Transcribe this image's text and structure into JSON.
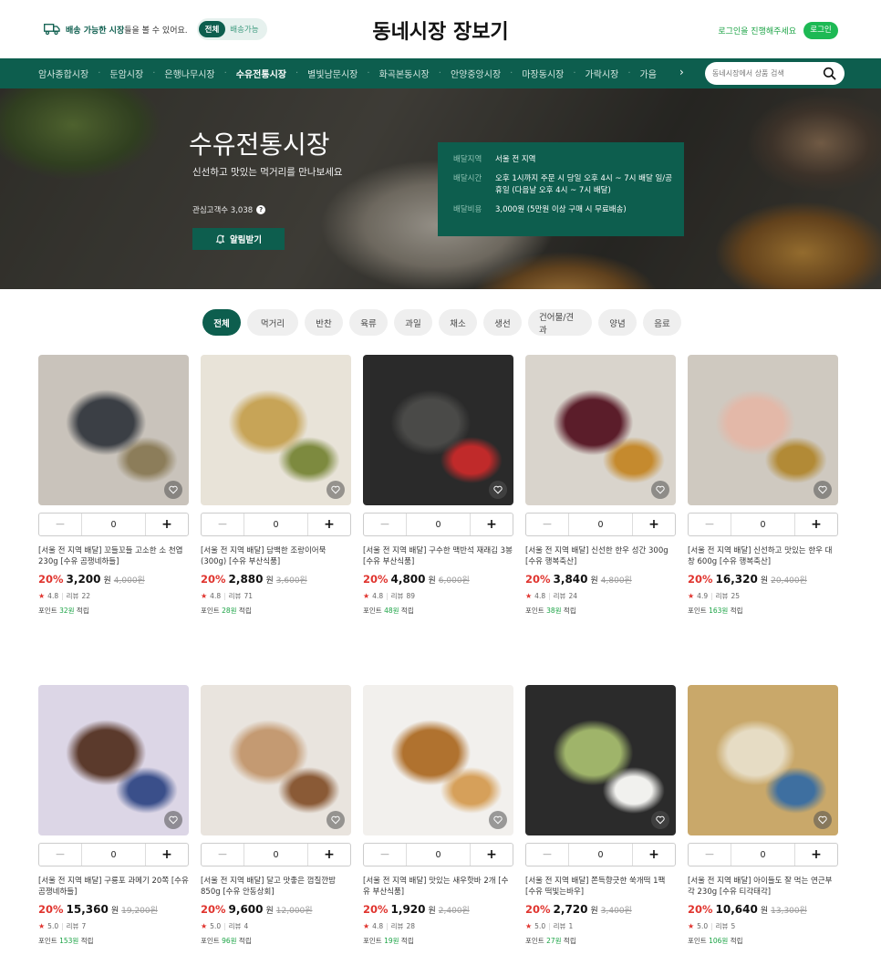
{
  "header": {
    "delivery_prefix": "배송 가능한 시장",
    "delivery_suffix": "들을 볼 수 있어요.",
    "toggle_all": "전체",
    "toggle_deliverable": "배송가능",
    "site_title": "동네시장 장보기",
    "login_prompt": "로그인을 진행해주세요",
    "login_button": "로그인"
  },
  "nav": {
    "items": [
      "암사종합시장",
      "둔암시장",
      "은행나무시장",
      "수유전통시장",
      "별빛남문시장",
      "화곡본동시장",
      "안양중앙시장",
      "마장동시장",
      "가락시장",
      "가음"
    ],
    "active_index": 3,
    "arrow": "›"
  },
  "search": {
    "placeholder": "동네시장에서 상품 검색"
  },
  "hero": {
    "title": "수유전통시장",
    "subtitle": "신선하고 맛있는 먹거리를 만나보세요",
    "followers_label": "관심고객수 3,038",
    "info_mark": "?",
    "notify_button": "알림받기",
    "info": [
      {
        "key": "배달지역",
        "value": "서울 전 지역"
      },
      {
        "key": "배달시간",
        "value": "오후 1시까지 주문 시 당일 오후 4시 ~ 7시 배달 일/공휴일 (다음날 오후 4시 ~ 7시 배달)"
      },
      {
        "key": "배달비용",
        "value": "3,000원 (5만원 이상 구매 시 무료배송)"
      }
    ]
  },
  "categories": [
    "전체",
    "먹거리",
    "반찬",
    "육류",
    "과일",
    "채소",
    "생선",
    "건어물/견과",
    "양념",
    "음료"
  ],
  "labels": {
    "won": "원",
    "review": "리뷰",
    "point_prefix": "포인트 ",
    "point_suffix": " 적립"
  },
  "products": [
    {
      "name": "[서울 전 지역 배달] 꼬들꼬들 고소한 소 천엽 230g [수유 곰쟁네하들]",
      "discount": "20%",
      "price": "3,200",
      "original": "4,000원",
      "rating": "4.8",
      "reviews": "22",
      "points": "32원",
      "qty": "0",
      "colors": [
        "#c9c3bb",
        "#3b3f45",
        "#8c7d5a"
      ]
    },
    {
      "name": "[서울 전 지역 배달] 담백한 조랑이어묵 (300g) [수유 부산식품]",
      "discount": "20%",
      "price": "2,880",
      "original": "3,600원",
      "rating": "4.8",
      "reviews": "71",
      "points": "28원",
      "qty": "0",
      "colors": [
        "#e8e3d8",
        "#c7a457",
        "#7d8a3f"
      ]
    },
    {
      "name": "[서울 전 지역 배달] 구수한 맥반석 재래김 3봉 [수유 부산식품]",
      "discount": "20%",
      "price": "4,800",
      "original": "6,000원",
      "rating": "4.8",
      "reviews": "89",
      "points": "48원",
      "qty": "0",
      "colors": [
        "#2a2a2a",
        "#4a4a48",
        "#c02a2a"
      ]
    },
    {
      "name": "[서울 전 지역 배달] 신선한 한우 성간 300g [수유 행복축산]",
      "discount": "20%",
      "price": "3,840",
      "original": "4,800원",
      "rating": "4.8",
      "reviews": "24",
      "points": "38원",
      "qty": "0",
      "colors": [
        "#d9d4cc",
        "#5b1d2a",
        "#c58a2e"
      ]
    },
    {
      "name": "[서울 전 지역 배달] 신선하고 맛있는 한우 대창 600g [수유 행복축산]",
      "discount": "20%",
      "price": "16,320",
      "original": "20,400원",
      "rating": "4.9",
      "reviews": "25",
      "points": "163원",
      "qty": "0",
      "colors": [
        "#cfc9c0",
        "#e3b8a8",
        "#b28a36"
      ]
    },
    {
      "name": "[서울 전 지역 배달] 구룡포 과메기 20쪽 [수유 곰쟁네하들]",
      "discount": "20%",
      "price": "15,360",
      "original": "19,200원",
      "rating": "5.0",
      "reviews": "7",
      "points": "153원",
      "qty": "0",
      "colors": [
        "#dcd6e6",
        "#5b3a2c",
        "#3a4f8a"
      ]
    },
    {
      "name": "[서울 전 지역 배달] 달고 맛좋은 껍질깐밤 850g [수유 안동상회]",
      "discount": "20%",
      "price": "9,600",
      "original": "12,000원",
      "rating": "5.0",
      "reviews": "4",
      "points": "96원",
      "qty": "0",
      "colors": [
        "#e9e4de",
        "#c49a72",
        "#8a5a36"
      ]
    },
    {
      "name": "[서울 전 지역 배달] 맛있는 새우핫바 2개 [수유 부산식품]",
      "discount": "20%",
      "price": "1,920",
      "original": "2,400원",
      "rating": "4.8",
      "reviews": "28",
      "points": "19원",
      "qty": "0",
      "colors": [
        "#f2f0ed",
        "#b0722f",
        "#d6a05a"
      ]
    },
    {
      "name": "[서울 전 지역 배달] 쫀득향긋한 쑥개떡 1팩 [수유 떡빛는바우]",
      "discount": "20%",
      "price": "2,720",
      "original": "3,400원",
      "rating": "5.0",
      "reviews": "1",
      "points": "27원",
      "qty": "0",
      "colors": [
        "#2b2b2b",
        "#9fb46a",
        "#f1f1ee"
      ]
    },
    {
      "name": "[서울 전 지역 배달] 아이들도 잘 먹는 연근부각 230g [수유 티각태각]",
      "discount": "20%",
      "price": "10,640",
      "original": "13,300원",
      "rating": "5.0",
      "reviews": "5",
      "points": "106원",
      "qty": "0",
      "colors": [
        "#c9a86a",
        "#e6dcc4",
        "#3e6fa0"
      ]
    }
  ]
}
